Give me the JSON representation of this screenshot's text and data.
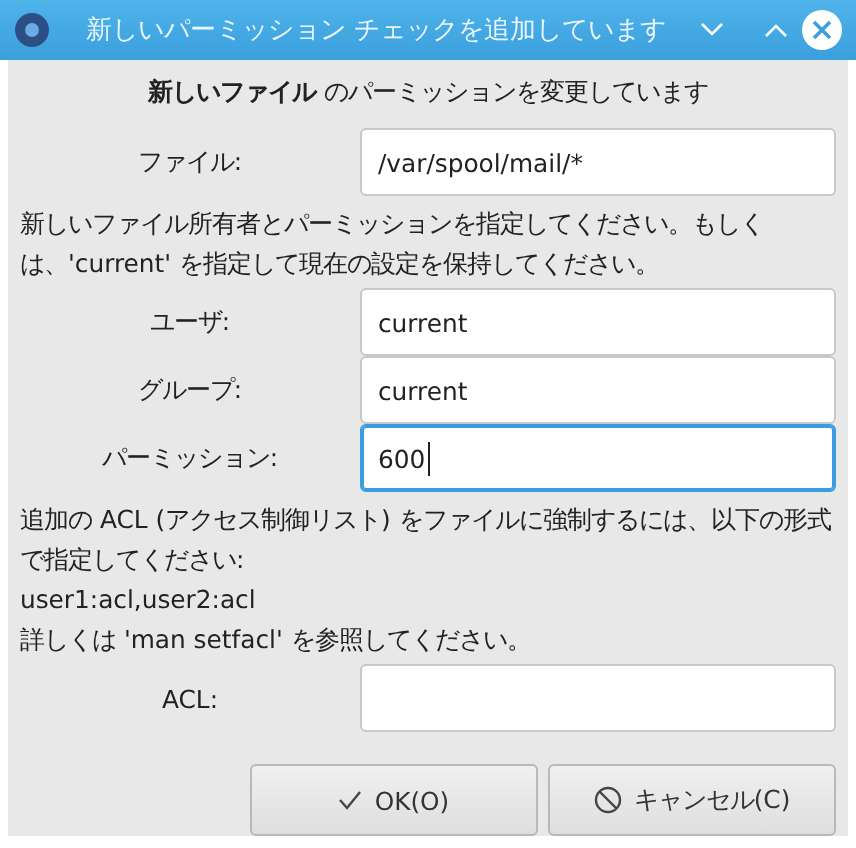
{
  "window": {
    "title": "新しいパーミッション チェックを追加しています"
  },
  "heading": "**新しいファイル** のパーミッションを変更しています",
  "file_field": {
    "label": "ファイル:",
    "value": "/var/spool/mail/*",
    "focused": false
  },
  "owner_note": "新しいファイル所有者とパーミッションを指定してください。もしくは、'current' を指定して現在の設定を保持してください。",
  "owner_fields": [
    {
      "label": "ユーザ:",
      "value": "current",
      "focused": false
    },
    {
      "label": "グループ:",
      "value": "current",
      "focused": false
    },
    {
      "label": "パーミッション:",
      "value": "600",
      "focused": true
    }
  ],
  "acl_note": [
    "追加の ACL (アクセス制御リスト) をファイルに強制するには、以下の形式で指定してください:",
    "user1:acl,user2:acl",
    "詳しくは 'man setfacl' を参照してください。"
  ],
  "acl_field": {
    "label": "ACL:",
    "focused": false
  },
  "buttons": [
    {
      "kind": "ok",
      "label": "OK(O)"
    },
    {
      "kind": "cancel",
      "label": "キャンセル(C)"
    }
  ]
}
